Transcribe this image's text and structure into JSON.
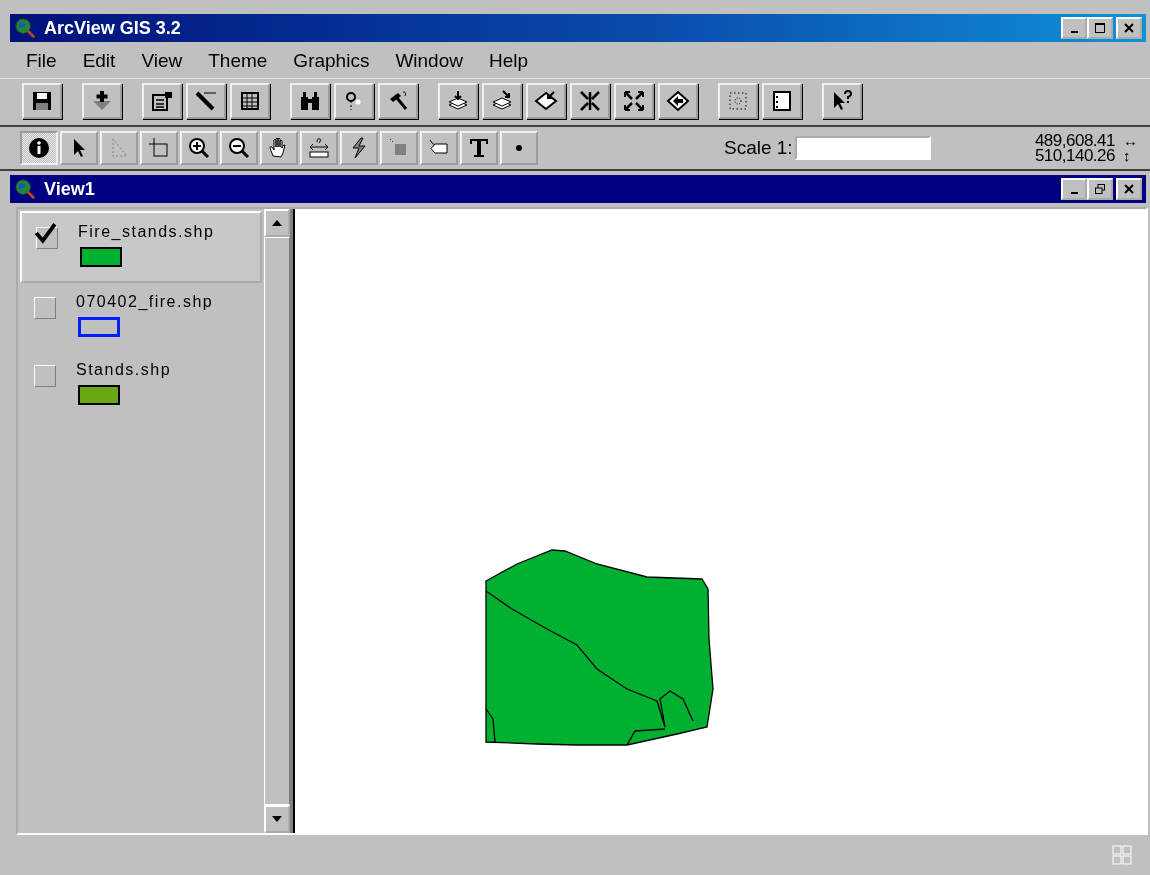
{
  "window": {
    "title": "ArcView GIS 3.2"
  },
  "menu": [
    {
      "label": "File"
    },
    {
      "label": "Edit"
    },
    {
      "label": "View"
    },
    {
      "label": "Theme"
    },
    {
      "label": "Graphics"
    },
    {
      "label": "Window"
    },
    {
      "label": "Help"
    }
  ],
  "tools": [
    {
      "selected": true
    },
    {
      "selected": false
    },
    {
      "selected": false
    },
    {
      "selected": false
    },
    {
      "selected": false
    },
    {
      "selected": false
    },
    {
      "selected": false
    },
    {
      "selected": false
    },
    {
      "selected": false
    },
    {
      "selected": false
    },
    {
      "selected": false
    },
    {
      "selected": false
    },
    {
      "selected": false
    }
  ],
  "scale": {
    "label": "Scale 1:"
  },
  "coordinates": [
    {
      "value": "489,608.41",
      "arrow": "↔"
    },
    {
      "value": "510,140.26",
      "arrow": "↕"
    }
  ],
  "view": {
    "title": "View1"
  },
  "themes": [
    {
      "name": "Fire_stands.shp",
      "checked": true,
      "selected": true,
      "kind": "fill",
      "color": "#00b030"
    },
    {
      "name": "070402_fire.shp",
      "checked": false,
      "selected": false,
      "kind": "outline",
      "color": "#0020ff"
    },
    {
      "name": "Stands.shp",
      "checked": false,
      "selected": false,
      "kind": "fill",
      "color": "#6aa815"
    }
  ]
}
